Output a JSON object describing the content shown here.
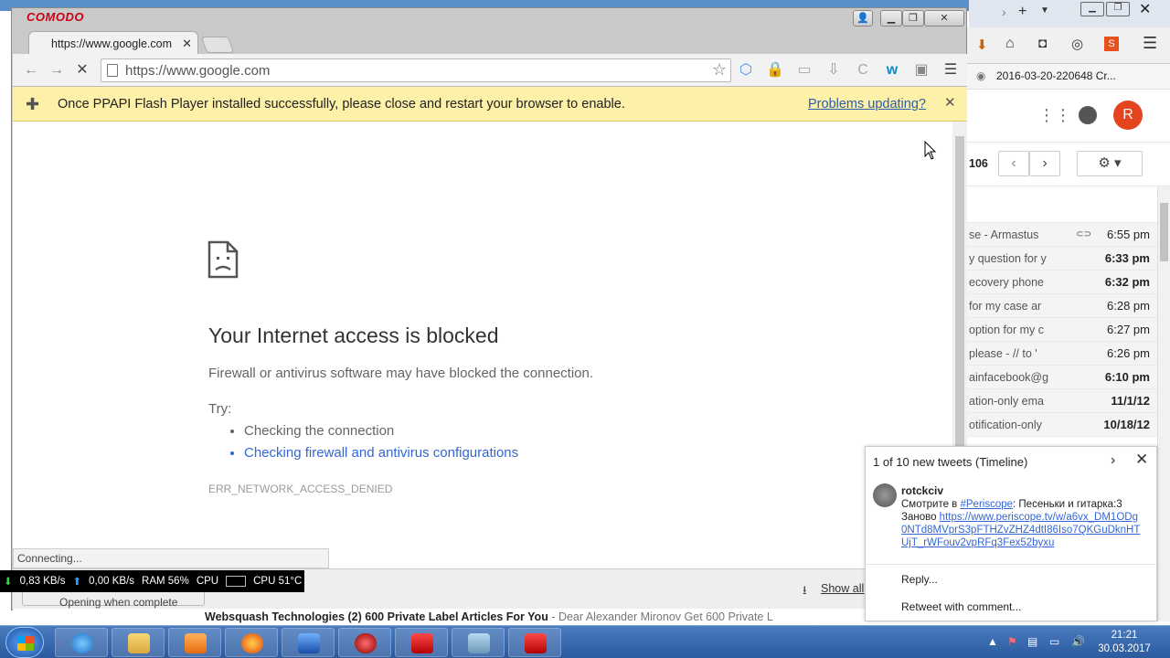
{
  "window": {
    "brand": "COMODO"
  },
  "tab": {
    "title": "https://www.google.com",
    "close": "✕"
  },
  "omnibox": {
    "url": "https://www.google.com"
  },
  "infobar": {
    "message": "Once PPAPI Flash Player installed successfully, please close and restart your browser to enable.",
    "link": "Problems updating?",
    "close": "✕"
  },
  "error": {
    "title": "Your Internet access is blocked",
    "description": "Firewall or antivirus software may have blocked the connection.",
    "try_label": "Try:",
    "suggestions": [
      "Checking the connection",
      "Checking firewall and antivirus configurations"
    ],
    "code": "ERR_NETWORK_ACCESS_DENIED"
  },
  "status": {
    "text": "Connecting..."
  },
  "download_bar": {
    "item_status": "Opening when complete",
    "show_all": "Show all"
  },
  "netmeter": {
    "down": "0,83 KB/s",
    "up": "0,00 KB/s",
    "ram": "RAM 56%",
    "cpu": "CPU",
    "cpu_temp": "CPU 51°C"
  },
  "bg_browser": {
    "bookmark": "2016-03-20-220648 Cr...",
    "avatar_letter": "R",
    "page_count": "106",
    "mails": [
      {
        "subject": "se - Armastus",
        "time": "6:55 pm",
        "unread": false
      },
      {
        "subject": "y question for y",
        "time": "6:33 pm",
        "unread": true
      },
      {
        "subject": "ecovery phone",
        "time": "6:32 pm",
        "unread": true
      },
      {
        "subject": "for my case ar",
        "time": "6:28 pm",
        "unread": false
      },
      {
        "subject": "option for my c",
        "time": "6:27 pm",
        "unread": false
      },
      {
        "subject": "please - // to '",
        "time": "6:26 pm",
        "unread": false
      },
      {
        "subject": "ainfacebook@g",
        "time": "6:10 pm",
        "unread": true
      },
      {
        "subject": "ation-only ema",
        "time": "11/1/12",
        "unread": true
      },
      {
        "subject": "otification-only",
        "time": "10/18/12",
        "unread": true
      }
    ],
    "bottom_sender": "Websquash Technologies (2)",
    "bottom_subject": "600 Private Label Articles For You",
    "bottom_snippet": "- Dear Alexander Mironov Get 600 Private L"
  },
  "tweet": {
    "header": "1 of 10 new tweets (Timeline)",
    "user": "rotckciv",
    "text_pre": "Смотрите в ",
    "hashtag": "#Periscope",
    "text_mid": ": Песеньки и гитарка:3 Заново ",
    "link": "https://www.periscope.tv/w/a6vx_DM1ODg0NTd8MVprS3pFTHZvZHZ4dtI86Iso7QKGuDknHTUjT_rWFouv2vpRFq3Fex52byxu",
    "reply": "Reply...",
    "retweet": "Retweet with comment..."
  },
  "taskbar": {
    "time": "21:21",
    "date": "30.03.2017"
  }
}
